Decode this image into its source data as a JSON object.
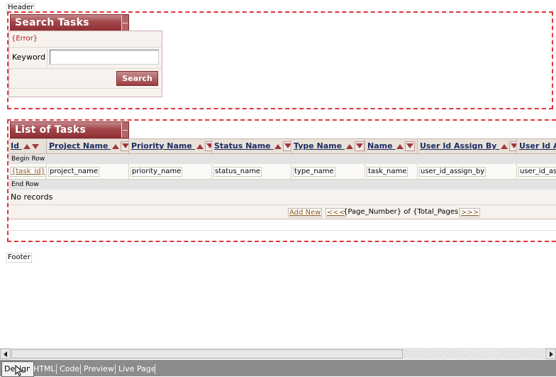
{
  "header_label": "Header",
  "footer_label": "Footer",
  "search_panel": {
    "title": "Search Tasks",
    "error": "{Error}",
    "keyword_label": "Keyword",
    "keyword_value": "",
    "search_button": "Search"
  },
  "list_panel": {
    "title": "List of Tasks",
    "columns": [
      "Id",
      "Project Name",
      "Priority Name",
      "Status Name",
      "Type Name",
      "Name",
      "User Id Assign By",
      "User Id As"
    ],
    "begin_row": "Begin Row",
    "end_row": "End Row",
    "cells": [
      "{task_id}",
      "project_name",
      "priority_name",
      "status_name",
      "type_name",
      "task_name",
      "user_id_assign_by",
      "user_id_as"
    ],
    "no_records": "No records",
    "add_new": "Add New",
    "prev": "<<<",
    "page_info": "{Page_Number} of {Total_Pages}",
    "next": ">>>"
  },
  "tabs": [
    "Design",
    "HTML",
    "Code",
    "Preview",
    "Live Page"
  ],
  "active_tab": "Design",
  "colors": {
    "accent": "#9c3e43",
    "zone_border": "#e0353b",
    "tabbar": "#8c8c8c"
  }
}
